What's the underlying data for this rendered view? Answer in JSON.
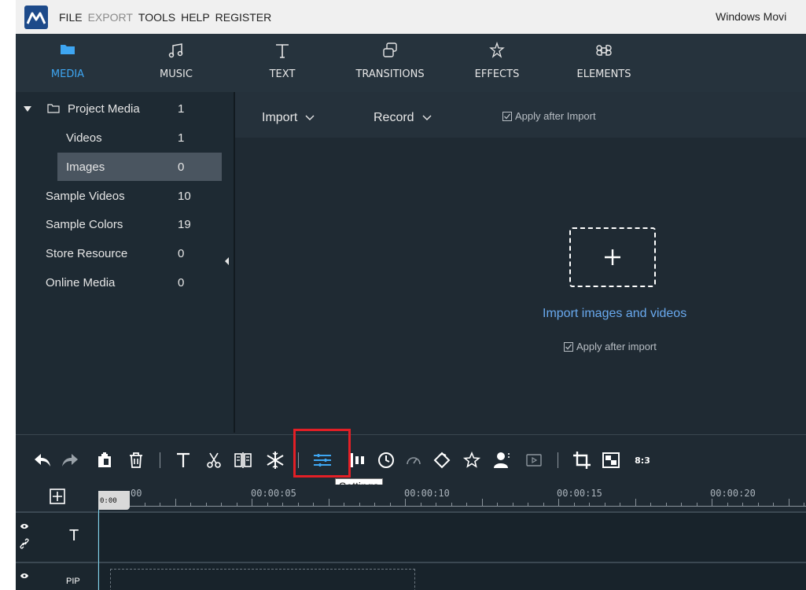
{
  "app": {
    "window_title": "Windows Movi",
    "brand_color": "#1d4a8a",
    "accent_color": "#3ea6f2",
    "highlight_color": "#e21f26"
  },
  "menu": [
    {
      "label": "FILE",
      "enabled": true
    },
    {
      "label": "EXPORT",
      "enabled": false
    },
    {
      "label": "TOOLS",
      "enabled": true
    },
    {
      "label": "HELP",
      "enabled": true
    },
    {
      "label": "REGISTER",
      "enabled": true
    }
  ],
  "categories": [
    {
      "label": "MEDIA",
      "icon": "folder-icon",
      "active": true
    },
    {
      "label": "MUSIC",
      "icon": "music-note-icon",
      "active": false
    },
    {
      "label": "TEXT",
      "icon": "text-icon",
      "active": false
    },
    {
      "label": "TRANSITIONS",
      "icon": "transitions-icon",
      "active": false
    },
    {
      "label": "EFFECTS",
      "icon": "effects-icon",
      "active": false
    },
    {
      "label": "ELEMENTS",
      "icon": "elements-icon",
      "active": false
    }
  ],
  "media_tree": {
    "project": {
      "label": "Project Media",
      "count": "1",
      "expanded": true
    },
    "items": [
      {
        "label": "Videos",
        "count": "1",
        "selected": false
      },
      {
        "label": "Images",
        "count": "0",
        "selected": true
      },
      {
        "label": "Sample Videos",
        "count": "10",
        "selected": false
      },
      {
        "label": "Sample Colors",
        "count": "19",
        "selected": false
      },
      {
        "label": "Store Resource",
        "count": "0",
        "selected": false
      },
      {
        "label": "Online Media",
        "count": "0",
        "selected": false
      }
    ]
  },
  "media_area": {
    "import_label": "Import",
    "record_label": "Record",
    "apply_top": "Apply after Import",
    "import_link": "Import images and videos",
    "apply_center": "Apply after import"
  },
  "edit_toolbar": {
    "tools": [
      "undo-icon",
      "redo-icon",
      "paste-icon",
      "delete-icon",
      "text-icon",
      "cut-icon",
      "split-icon",
      "freeze-icon",
      "settings-icon",
      "audio-bars-icon",
      "duration-icon",
      "speed-icon",
      "rotate-icon",
      "favorite-icon",
      "person-icon",
      "preview-icon",
      "crop-icon",
      "pip-icon",
      "aspect-icon"
    ],
    "aspect_label": "8:3",
    "highlighted_tool": "settings-icon",
    "tooltip": "Settings"
  },
  "timeline": {
    "playhead": "0:00",
    "playhead_suffix": "00",
    "timecodes": [
      "00:00:05",
      "00:00:10",
      "00:00:15",
      "00:00:20"
    ],
    "tracks": [
      {
        "label": "T",
        "icon": "text-track-icon"
      },
      {
        "label": "PIP",
        "icon": "pip-track-icon"
      }
    ]
  }
}
